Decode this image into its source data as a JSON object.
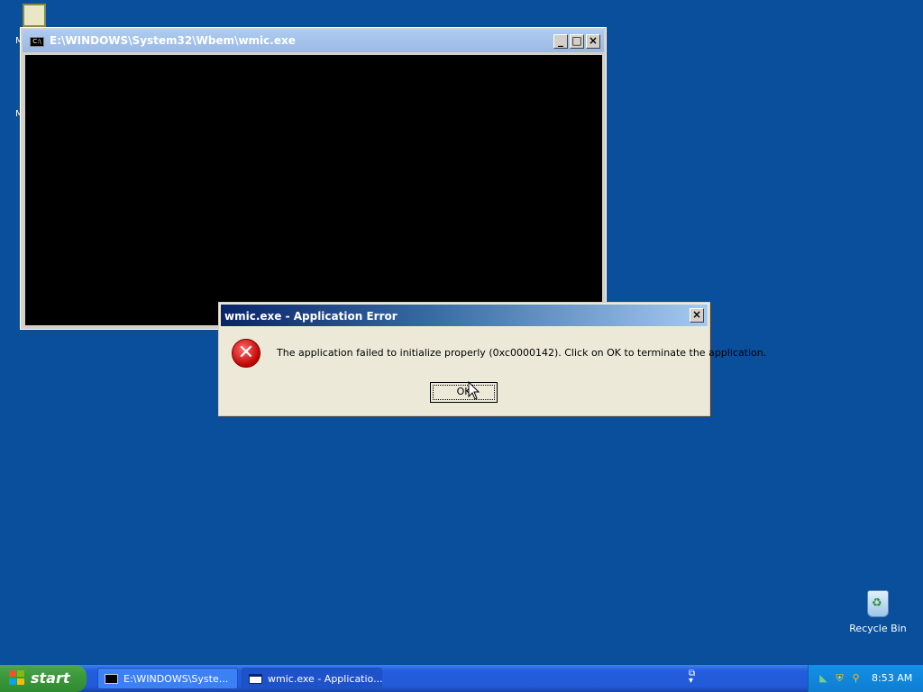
{
  "console_window": {
    "title": "E:\\WINDOWS\\System32\\Wbem\\wmic.exe",
    "icon": "console-icon",
    "minimize_glyph": "_",
    "maximize_glyph": "□",
    "close_glyph": "×"
  },
  "error_dialog": {
    "title": "wmic.exe - Application Error",
    "icon": "error-icon",
    "message": "The application failed to initialize properly (0xc0000142). Click on OK to terminate the application.",
    "ok_label": "OK",
    "close_glyph": "×"
  },
  "desktop": {
    "recycle_bin_label": "Recycle Bin",
    "background_color": "#0a4f9c"
  },
  "taskbar": {
    "start_label": "start",
    "tasks": [
      {
        "label": "E:\\WINDOWS\\Syste...",
        "icon": "console-icon"
      },
      {
        "label": "wmic.exe - Applicatio...",
        "icon": "window-icon"
      }
    ],
    "clock": "8:53 AM",
    "tray_icons": [
      "network-icon",
      "security-shield-icon",
      "search-icon"
    ]
  },
  "colors": {
    "dialog_title_gradient_start": "#0a246a",
    "dialog_title_gradient_end": "#a6caf0",
    "taskbar_blue": "#245edc",
    "start_green": "#3c9a3c",
    "error_red": "#c00000"
  }
}
